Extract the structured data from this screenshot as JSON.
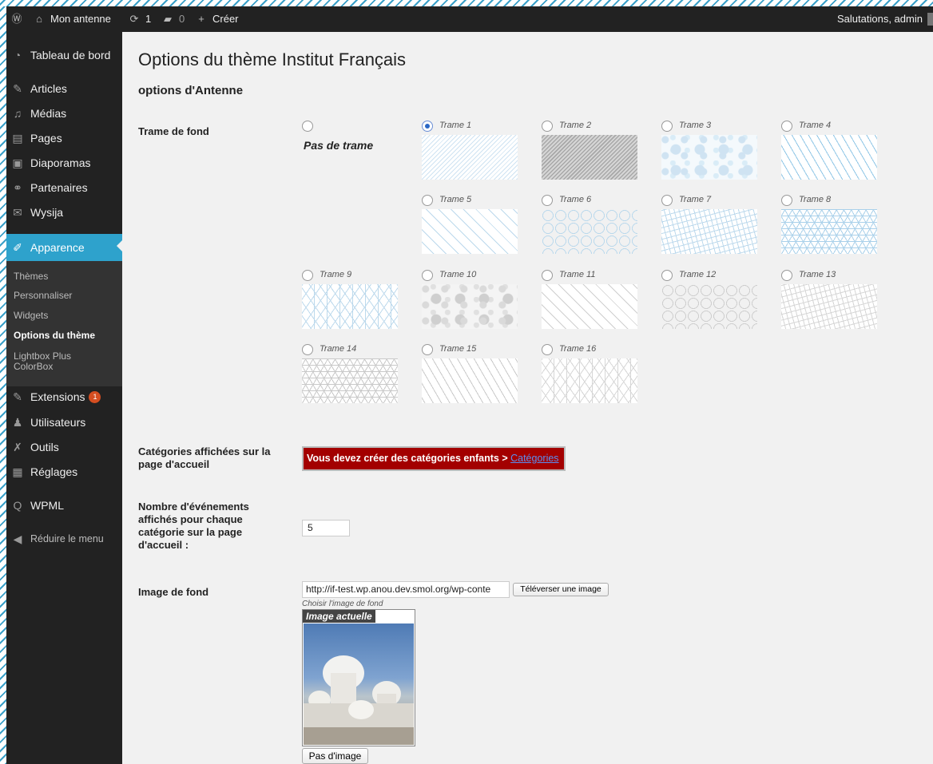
{
  "admin_bar": {
    "site_name": "Mon antenne",
    "updates_count": "1",
    "comments_count": "0",
    "new_label": "Créer",
    "greeting": "Salutations, admin"
  },
  "sidebar": {
    "dashboard": "Tableau de bord",
    "items": [
      {
        "label": "Articles",
        "icon": "pin-icon"
      },
      {
        "label": "Médias",
        "icon": "media-icon"
      },
      {
        "label": "Pages",
        "icon": "pages-icon"
      },
      {
        "label": "Diaporamas",
        "icon": "slideshow-icon"
      },
      {
        "label": "Partenaires",
        "icon": "partners-icon"
      },
      {
        "label": "Wysija",
        "icon": "mail-icon"
      }
    ],
    "active": "Apparence",
    "submenu": [
      "Thèmes",
      "Personnaliser",
      "Widgets",
      "Options du thème",
      "Lightbox Plus ColorBox"
    ],
    "extensions": "Extensions",
    "extensions_badge": "1",
    "users": "Utilisateurs",
    "tools": "Outils",
    "settings": "Réglages",
    "wpml": "WPML",
    "collapse": "Réduire le menu"
  },
  "page": {
    "title": "Options du thème Institut Français",
    "section_title": "options d'Antenne"
  },
  "background_pattern": {
    "label": "Trame de fond",
    "none_label": "Pas de trame",
    "selected": "Trame 1",
    "options": [
      "Trame 1",
      "Trame 2",
      "Trame 3",
      "Trame 4",
      "Trame 5",
      "Trame 6",
      "Trame 7",
      "Trame 8",
      "Trame 9",
      "Trame 10",
      "Trame 11",
      "Trame 12",
      "Trame 13",
      "Trame 14",
      "Trame 15",
      "Trame 16"
    ]
  },
  "categories": {
    "label": "Catégories affichées sur la page d'accueil",
    "error_text": "Vous devez créer des catégories enfants > ",
    "error_link": "Catégories"
  },
  "events_count": {
    "label": "Nombre d'événements affichés pour chaque catégorie sur la page d'accueil :",
    "value": "5"
  },
  "background_image": {
    "label": "Image de fond",
    "url_value": "http://if-test.wp.anou.dev.smol.org/wp-conte",
    "upload_button": "Téléverser une image",
    "hint": "Choisir l'image de fond",
    "current_caption": "Image actuelle",
    "no_image_button": "Pas d'image"
  }
}
